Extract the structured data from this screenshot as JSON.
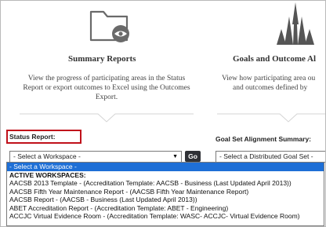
{
  "summary_reports": {
    "title": "Summary Reports",
    "description_lines": [
      "View the progress of participating areas in the Status",
      "Report or export outcomes to Excel using the Outcomes",
      "Export."
    ]
  },
  "goals_outcomes": {
    "title": "Goals and Outcome Al",
    "description_lines": [
      "View how participating area ou",
      "and outcomes defined by"
    ]
  },
  "status_report": {
    "label": "Status Report:",
    "select_value": "- Select a Workspace -",
    "go_label": "Go"
  },
  "goal_set": {
    "label": "Goal Set Alignment Summary:",
    "select_value": "- Select a Distributed Goal Set -"
  },
  "dropdown": {
    "options": [
      "- Select a Workspace -",
      "ACTIVE WORKSPACES:",
      "AACSB 2013 Template - (Accreditation Template: AACSB - Business (Last Updated April 2013))",
      "AACSB Fifth Year Maintenance Report - (AACSB Fifth Year Maintenance Report)",
      "AACSB Report - (AACSB - Business (Last Updated April 2013))",
      "ABET Accreditation Report - (Accreditation Template: ABET - Engineering)",
      "ACCJC Virtual Evidence Room - (Accreditation Template: WASC- ACCJC- Virtual Evidence Room)"
    ]
  },
  "icons": {
    "left": "folder-eye-icon",
    "right": "goals-tower-icon"
  }
}
